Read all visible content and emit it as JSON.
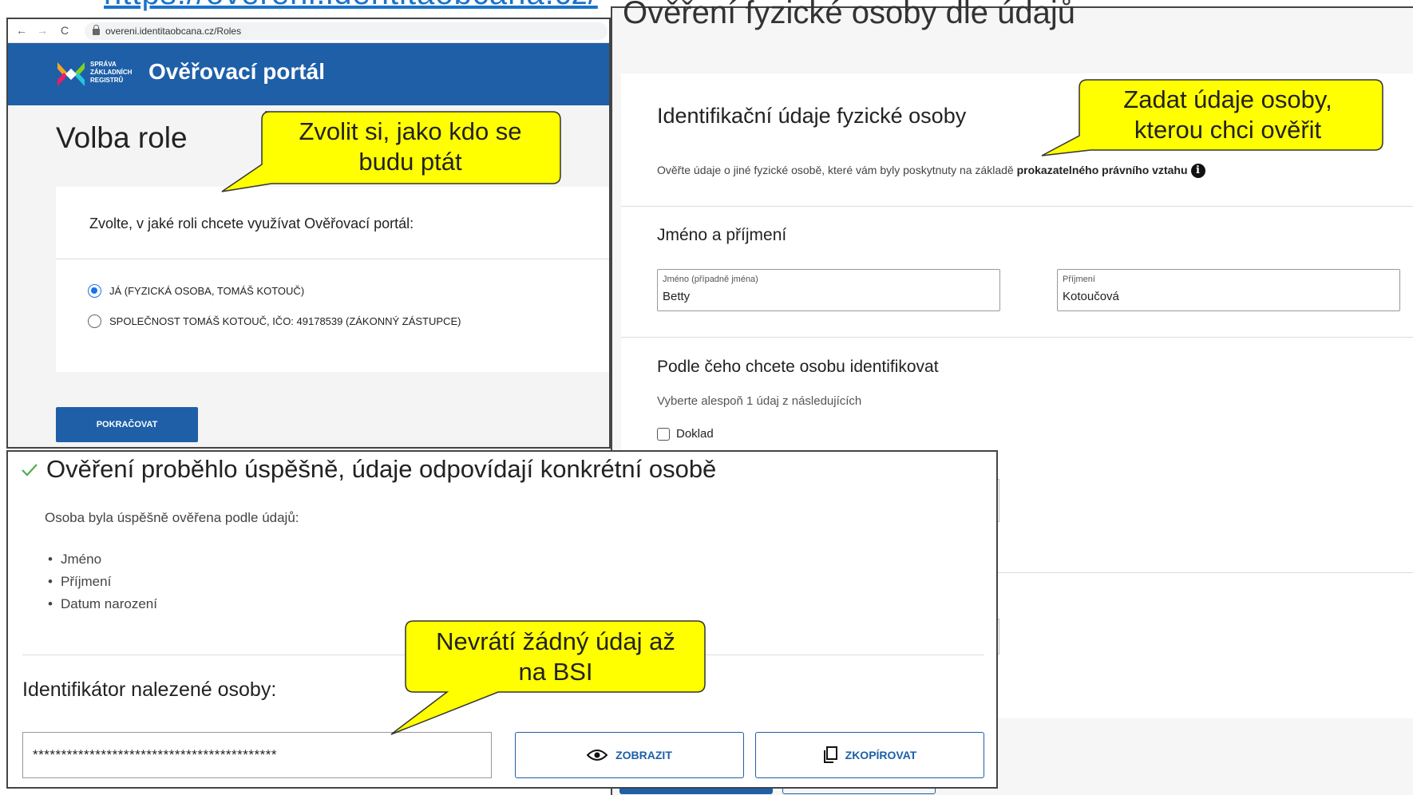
{
  "top_url": "https://overeni.identitaobcana.cz/",
  "right_panel": {
    "title": "Ověření fyzické osoby dle údajů",
    "id_heading": "Identifikační údaje fyzické osoby",
    "id_desc_prefix": "Ověřte údaje o jiné fyzické osobě, které vám byly poskytnuty na základě ",
    "id_desc_bold": "prokazatelného právního vztahu",
    "info_icon": "i",
    "name_heading": "Jméno a příjmení",
    "first_name": {
      "label": "Jméno (případně jména)",
      "value": "Betty"
    },
    "last_name": {
      "label": "Příjmení",
      "value": "Kotoučová"
    },
    "ident_heading": "Podle čeho chcete osobu identifikovat",
    "ident_hint": "Vyberte alespoň 1 údaj z následujících",
    "doklad_label": "Doklad"
  },
  "browser": {
    "url": "overeni.identitaobcana.cz/Roles",
    "nav_icons": {
      "back": "←",
      "forward": "→",
      "reload": "C"
    },
    "logo_lines": [
      "SPRÁVA",
      "ZÁKLADNÍCH",
      "REGISTRŮ"
    ],
    "portal_title": "Ověřovací portál",
    "role_title": "Volba role",
    "role_question": "Zvolte, v jaké roli chcete využívat Ověřovací portál:",
    "role_options": [
      {
        "label": "JÁ (FYZICKÁ OSOBA, TOMÁŠ KOTOUČ)",
        "selected": true
      },
      {
        "label": "SPOLEČNOST TOMÁŠ KOTOUČ, IČO: 49178539 (ZÁKONNÝ ZÁSTUPCE)",
        "selected": false
      }
    ],
    "continue_label": "POKRAČOVAT"
  },
  "result": {
    "success_title": "Ověření proběhlo úspěšně, údaje odpovídají konkrétní osobě",
    "desc": "Osoba byla úspěšně ověřena podle údajů:",
    "verified_fields": [
      "Jméno",
      "Příjmení",
      "Datum narození"
    ],
    "identifier_label": "Identifikátor nalezené osoby:",
    "identifier_value": "*******************************************",
    "show_label": "ZOBRAZIT",
    "copy_label": "ZKOPÍROVAT"
  },
  "callouts": [
    {
      "lines": [
        "Zvolit si, jako kdo se",
        "budu ptát"
      ]
    },
    {
      "lines": [
        "Zadat údaje osoby,",
        "kterou chci ověřit"
      ]
    },
    {
      "lines": [
        "Nevrátí žádný údaj až",
        "na BSI"
      ]
    }
  ],
  "colors": {
    "brand_blue": "#1e5fa8",
    "link_blue": "#1a73c8",
    "callout_fill": "#ffff00",
    "success_check": "#4caf50"
  }
}
